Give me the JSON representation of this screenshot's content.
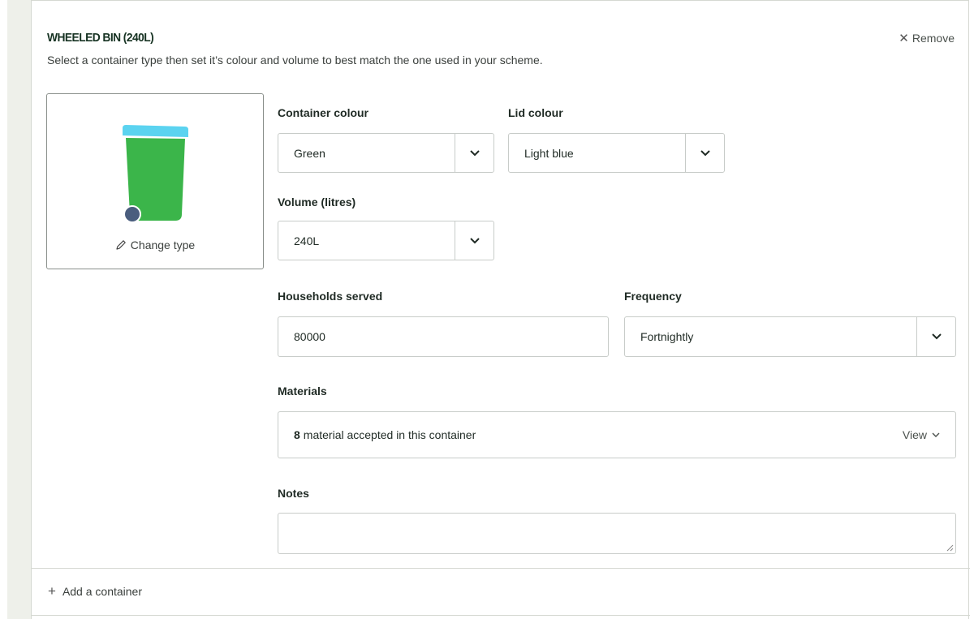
{
  "container": {
    "title": "WHEELED BIN (240L)",
    "description": "Select a container type then set it’s colour and volume to best match the one used in your scheme.",
    "remove_label": "Remove",
    "change_type_label": "Change type",
    "bin_colors": {
      "body": "#3bb54a",
      "lid": "#5bd3f0",
      "wheel": "#4a5d7e"
    }
  },
  "fields": {
    "container_colour": {
      "label": "Container colour",
      "value": "Green"
    },
    "lid_colour": {
      "label": "Lid colour",
      "value": "Light blue"
    },
    "volume": {
      "label": "Volume (litres)",
      "value": "240L"
    },
    "households": {
      "label": "Households served",
      "value": "80000"
    },
    "frequency": {
      "label": "Frequency",
      "value": "Fortnightly"
    },
    "materials": {
      "label": "Materials",
      "count": "8",
      "text": "material accepted in this container",
      "view_label": "View"
    },
    "notes": {
      "label": "Notes",
      "value": ""
    }
  },
  "footer": {
    "add_label": "Add a container"
  }
}
